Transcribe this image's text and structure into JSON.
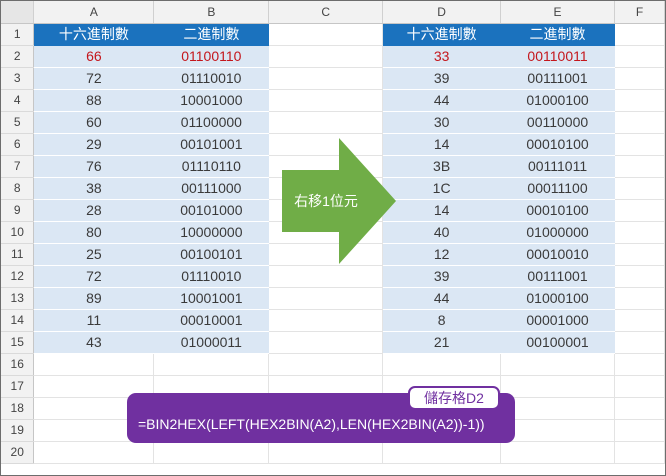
{
  "sheet": {
    "corner": "",
    "columns": [
      "A",
      "B",
      "C",
      "D",
      "E",
      "F"
    ],
    "row_numbers": [
      "1",
      "2",
      "3",
      "4",
      "5",
      "6",
      "7",
      "8",
      "9",
      "10",
      "11",
      "12",
      "13",
      "14",
      "15",
      "16",
      "17",
      "18",
      "19",
      "20"
    ],
    "left_table": {
      "header": [
        "十六進制數",
        "二進制數"
      ],
      "rows": [
        [
          "66",
          "01100110"
        ],
        [
          "72",
          "01110010"
        ],
        [
          "88",
          "10001000"
        ],
        [
          "60",
          "01100000"
        ],
        [
          "29",
          "00101001"
        ],
        [
          "76",
          "01110110"
        ],
        [
          "38",
          "00111000"
        ],
        [
          "28",
          "00101000"
        ],
        [
          "80",
          "10000000"
        ],
        [
          "25",
          "00100101"
        ],
        [
          "72",
          "01110010"
        ],
        [
          "89",
          "10001001"
        ],
        [
          "11",
          "00010001"
        ],
        [
          "43",
          "01000011"
        ]
      ]
    },
    "right_table": {
      "header": [
        "十六進制數",
        "二進制數"
      ],
      "rows": [
        [
          "33",
          "00110011"
        ],
        [
          "39",
          "00111001"
        ],
        [
          "44",
          "01000100"
        ],
        [
          "30",
          "00110000"
        ],
        [
          "14",
          "00010100"
        ],
        [
          "3B",
          "00111011"
        ],
        [
          "1C",
          "00011100"
        ],
        [
          "14",
          "00010100"
        ],
        [
          "40",
          "01000000"
        ],
        [
          "12",
          "00010010"
        ],
        [
          "39",
          "00111001"
        ],
        [
          "44",
          "01000100"
        ],
        [
          "8",
          "00001000"
        ],
        [
          "21",
          "00100001"
        ]
      ]
    }
  },
  "arrow": {
    "label": "右移1位元",
    "color": "#70ad47"
  },
  "formula": {
    "cell_label": "儲存格D2",
    "text": "=BIN2HEX(LEFT(HEX2BIN(A2),LEN(HEX2BIN(A2))-1))"
  },
  "colors": {
    "header_fill": "#1b72be",
    "data_fill": "#dbe7f4",
    "highlight_text": "#c4161c",
    "formula_fill": "#7030a0"
  }
}
